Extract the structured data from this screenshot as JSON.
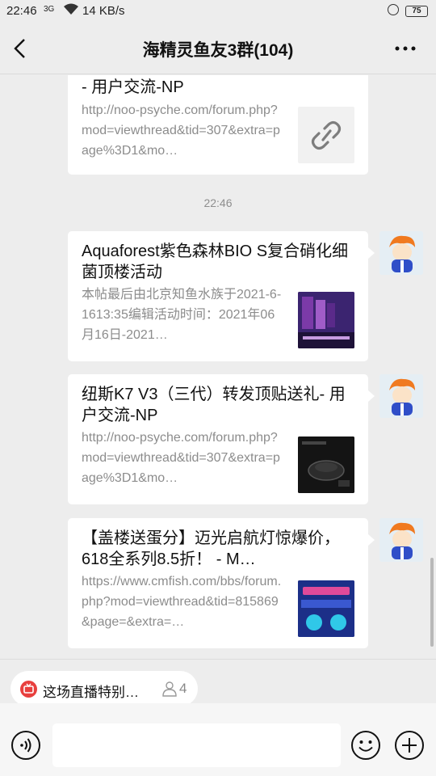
{
  "status_bar": {
    "time": "22:46",
    "signal": "3G",
    "speed": "14 KB/s",
    "battery": "75"
  },
  "header": {
    "title": "海精灵鱼友3群(104)",
    "back_icon": "chevron-left-icon",
    "more_icon": "more-dots-icon"
  },
  "messages": [
    {
      "title": "- 用户交流-NP",
      "desc": "http://noo-psyche.com/forum.php?mod=viewthread&tid=307&extra=page%3D1&mo…",
      "thumb_icon": "link-icon"
    },
    {
      "type": "timestamp",
      "text": "22:46"
    },
    {
      "title": "Aquaforest紫色森林BIO S复合硝化细菌顶楼活动",
      "desc": "本帖最后由北京知鱼水族于2021-6-1613:35编辑活动时间：2021年06月16日-2021…",
      "thumb_icon": "product-image"
    },
    {
      "title": "纽斯K7 V3（三代）转发顶贴送礼- 用户交流-NP",
      "desc": "http://noo-psyche.com/forum.php?mod=viewthread&tid=307&extra=page%3D1&mo…",
      "thumb_icon": "light-image"
    },
    {
      "title": "【盖楼送蛋分】迈光启航灯惊爆价，618全系列8.5折！ - M…",
      "desc": "https://www.cmfish.com/bbs/forum.php?mod=viewthread&tid=815869&page=&extra=…",
      "thumb_icon": "promo-image"
    }
  ],
  "live_bar": {
    "text": "这场直播特别…",
    "viewer_count": "4"
  },
  "input_bar": {
    "placeholder": ""
  },
  "colors": {
    "background": "#ededed",
    "bubble": "#ffffff",
    "live_red": "#e8403e",
    "meta_gray": "#8c8c8c"
  }
}
